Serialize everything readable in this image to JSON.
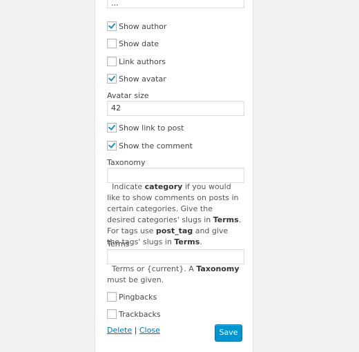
{
  "widget": {
    "top_input_value": "...",
    "checkboxes_top": [
      {
        "label": "Show author",
        "checked": true
      },
      {
        "label": "Show date",
        "checked": false
      },
      {
        "label": "Link authors",
        "checked": false
      },
      {
        "label": "Show avatar",
        "checked": true
      }
    ],
    "avatar_size": {
      "label": "Avatar size",
      "value": "42"
    },
    "checkboxes_mid": [
      {
        "label": "Show link to post",
        "checked": true
      },
      {
        "label": "Show the comment",
        "checked": true
      }
    ],
    "taxonomy": {
      "label": "Taxonomy",
      "value": "",
      "help": {
        "p1": "Indicate ",
        "b1": "category",
        "p2": " if you would like to show comments on posts in certain categories. Give the desired categories' slugs in ",
        "b2": "Terms",
        "p3": ". For tags use ",
        "b3": "post_tag",
        "p4": " and give the tags' slugs in ",
        "b4": "Terms",
        "p5": "."
      }
    },
    "terms": {
      "label": "Terms",
      "value": "",
      "help": {
        "p1": "Terms or {current}. A ",
        "b1": "Taxonomy",
        "p2": " must be given."
      }
    },
    "checkboxes_bottom": [
      {
        "label": "Pingbacks",
        "checked": false
      },
      {
        "label": "Trackbacks",
        "checked": false
      }
    ],
    "actions": {
      "delete_label": "Delete",
      "separator": "|",
      "close_label": "Close",
      "save_label": "Save"
    }
  }
}
